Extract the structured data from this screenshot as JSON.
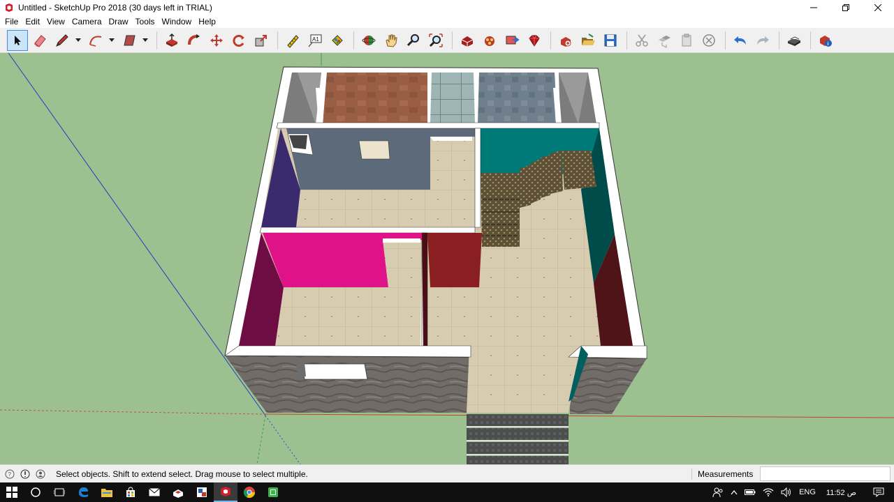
{
  "window": {
    "title": "Untitled - SketchUp Pro 2018 (30 days left in TRIAL)"
  },
  "menu": [
    "File",
    "Edit",
    "View",
    "Camera",
    "Draw",
    "Tools",
    "Window",
    "Help"
  ],
  "toolbar": {
    "tools": [
      "select-tool",
      "eraser-tool",
      "line-tool",
      "arc-tool",
      "rectangle-tool",
      "push-pull-tool",
      "follow-me-tool",
      "move-tool",
      "rotate-tool",
      "scale-tool",
      "tape-measure-tool",
      "text-tool",
      "paint-bucket-tool",
      "orbit-tool",
      "pan-tool",
      "zoom-tool",
      "zoom-extents-tool",
      "3d-warehouse",
      "extension-warehouse",
      "send-to-layout",
      "extension-manager",
      "new-file",
      "open-file",
      "save-file",
      "cut",
      "copy",
      "paste",
      "erase",
      "undo",
      "redo",
      "print",
      "model-info"
    ],
    "active_tool": "select-tool"
  },
  "status": {
    "message": "Select objects. Shift to extend select. Drag mouse to select multiple.",
    "measurements_label": "Measurements",
    "measurements_value": ""
  },
  "taskbar": {
    "language": "ENG",
    "time": "11:52 ص"
  },
  "colors": {
    "ground": "#9cc08f",
    "wall_top": "#ffffff",
    "floor_tile": "#d8cdb3",
    "magenta_wall": "#e0138a",
    "teal_wall": "#007a76",
    "dark_red_wall": "#8a1f22",
    "slate_wall": "#5d6b7c",
    "indigo_wall": "#3a2a6a",
    "stone_exterior": "#6f6a66"
  }
}
